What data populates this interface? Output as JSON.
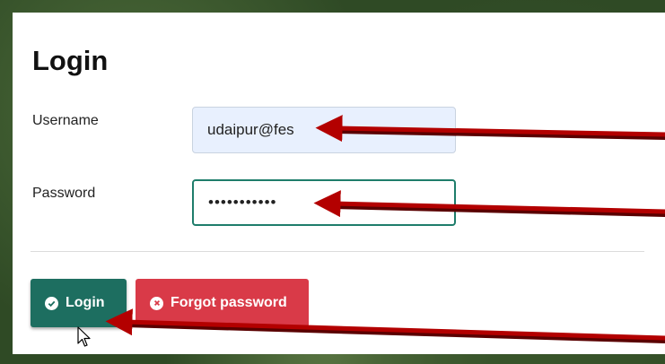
{
  "form": {
    "title": "Login",
    "username_label": "Username",
    "username_value": "udaipur@fes",
    "password_label": "Password",
    "password_value": "•••••••••••"
  },
  "buttons": {
    "login_label": "Login",
    "forgot_label": "Forgot password"
  },
  "colors": {
    "login_button": "#1d6e60",
    "forgot_button": "#d93a48",
    "annotation_arrow": "#b30000",
    "username_field_bg": "#e8f0fe",
    "password_focus_border": "#1e7d6b"
  },
  "icons": {
    "login": "check-circle-icon",
    "forgot": "x-circle-icon",
    "cursor": "mouse-pointer-icon"
  }
}
